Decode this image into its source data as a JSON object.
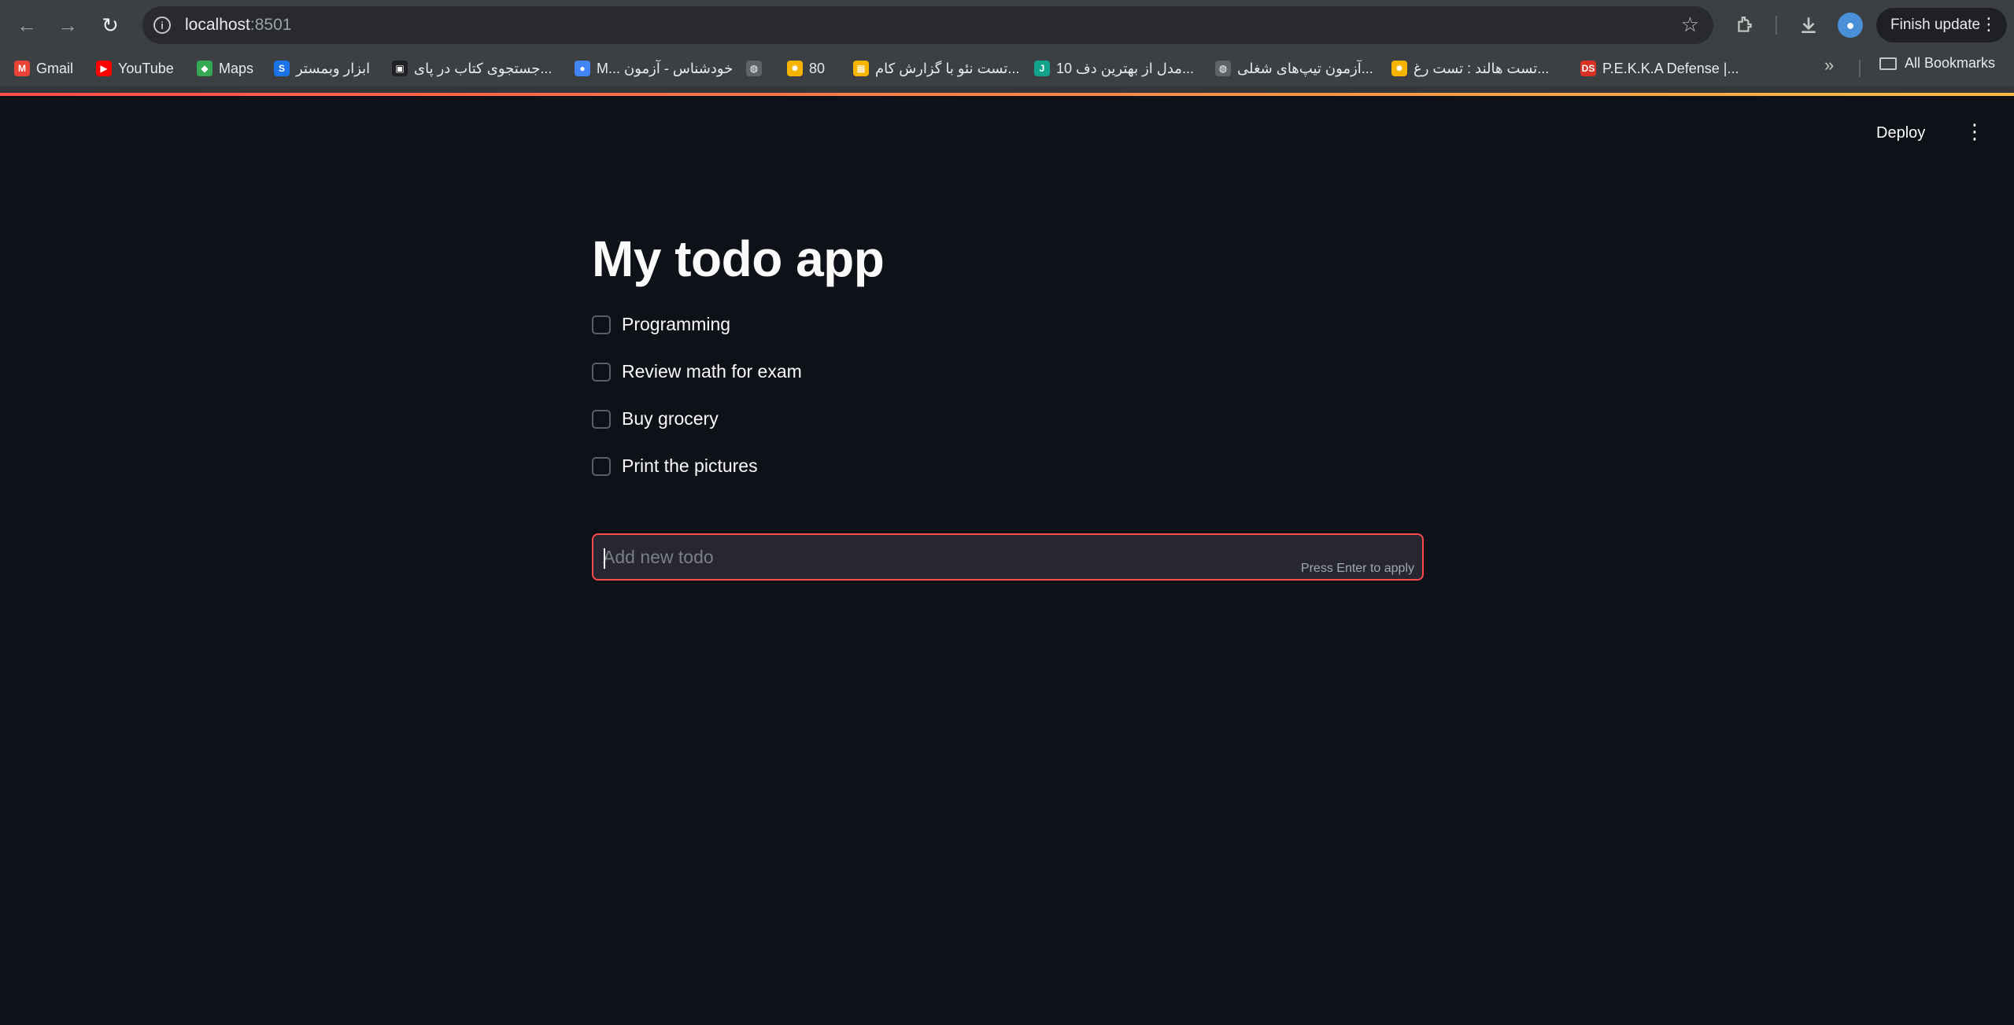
{
  "browser": {
    "url_host": "localhost",
    "url_port": ":8501",
    "finish_update_label": "Finish update",
    "all_bookmarks_label": "All Bookmarks",
    "bookmarks": [
      {
        "label": "Gmail",
        "icon": "gmail-icon",
        "color": "#ea4335",
        "glyph": "M"
      },
      {
        "label": "YouTube",
        "icon": "youtube-icon",
        "color": "#ff0000",
        "glyph": "▶"
      },
      {
        "label": "Maps",
        "icon": "maps-icon",
        "color": "#34a853",
        "glyph": "◆"
      },
      {
        "label": "ابزار وبمستر",
        "icon": "webmaster-icon",
        "color": "#1a73e8",
        "glyph": "S"
      },
      {
        "label": "جستجوی کتاب در پای...",
        "icon": "book-search-icon",
        "color": "#202124",
        "glyph": "▣"
      },
      {
        "label": "M... خودشناس - آزمون",
        "icon": "test-icon",
        "color": "#4285f4",
        "glyph": "●"
      },
      {
        "label": "",
        "icon": "globe-icon",
        "color": "#5f6368",
        "glyph": "◍"
      },
      {
        "label": "80",
        "icon": "pinwheel-icon",
        "color": "#f4b400",
        "glyph": "✸"
      },
      {
        "label": "تست نئو با گزارش کام...",
        "icon": "grid-icon",
        "color": "#f4b400",
        "glyph": "▦"
      },
      {
        "label": "10 مدل از بهترین دف...",
        "icon": "j-icon",
        "color": "#12a48a",
        "glyph": "J"
      },
      {
        "label": "آزمون تیپ‌های شغلی...",
        "icon": "globe-icon",
        "color": "#5f6368",
        "glyph": "◍"
      },
      {
        "label": "تست هالند : تست رغ...",
        "icon": "pinwheel-icon",
        "color": "#f4b400",
        "glyph": "✸"
      },
      {
        "label": "P.E.K.K.A Defense |...",
        "icon": "ds-icon",
        "color": "#d93025",
        "glyph": "DS"
      }
    ]
  },
  "header": {
    "deploy_label": "Deploy",
    "menu_icon": "kebab-menu-icon"
  },
  "main": {
    "title": "My todo app",
    "todos": [
      {
        "label": "Programming",
        "checked": false
      },
      {
        "label": "Review math for exam",
        "checked": false
      },
      {
        "label": "Buy grocery",
        "checked": false
      },
      {
        "label": "Print the pictures",
        "checked": false
      }
    ],
    "new_todo": {
      "value": "",
      "placeholder": "Add new todo",
      "hint": "Press Enter to apply"
    }
  },
  "colors": {
    "background": "#0e1117",
    "text": "#fafafa",
    "accent": "#ff4b4b",
    "input_bg": "#262730"
  }
}
